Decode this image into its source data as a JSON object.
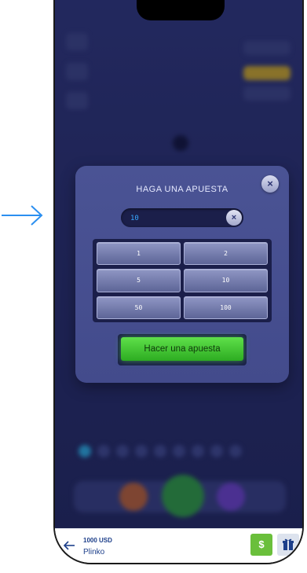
{
  "modal": {
    "title": "HAGA UNA APUESTA",
    "amount_value": "10",
    "close_glyph": "×",
    "clear_glyph": "×",
    "amounts": [
      "1",
      "2",
      "5",
      "10",
      "50",
      "100"
    ],
    "submit_label": "Hacer una apuesta"
  },
  "bottom_bar": {
    "balance": "1000 USD",
    "game_name": "Plinko",
    "cash_glyph": "$"
  },
  "icons": {
    "pointer": "arrow-right-icon",
    "back": "arrow-left-icon",
    "cash": "dollar-icon",
    "gift": "gift-icon"
  },
  "colors": {
    "accent_blue": "#2b8ff0",
    "submit_green": "#3ec12e",
    "cash_green": "#6abf3b",
    "modal_bg": "#4a5394"
  }
}
